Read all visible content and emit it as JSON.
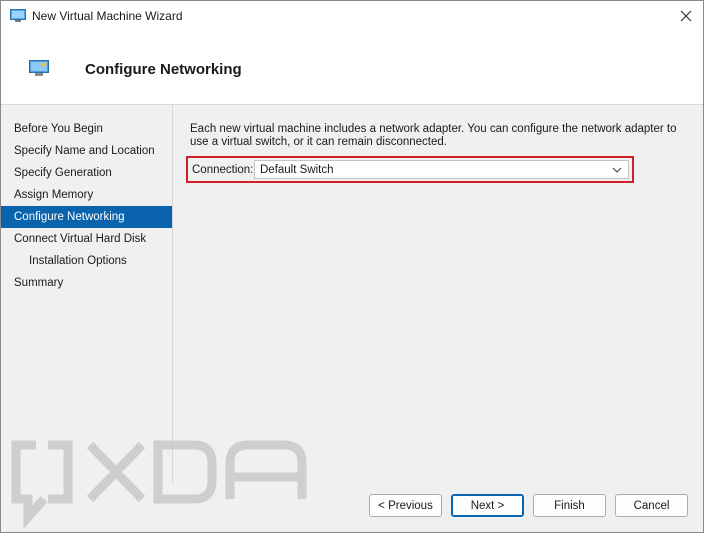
{
  "window": {
    "title": "New Virtual Machine Wizard"
  },
  "header": {
    "page_title": "Configure Networking"
  },
  "sidebar": {
    "items": [
      {
        "label": "Before You Begin",
        "active": false,
        "sub": false
      },
      {
        "label": "Specify Name and Location",
        "active": false,
        "sub": false
      },
      {
        "label": "Specify Generation",
        "active": false,
        "sub": false
      },
      {
        "label": "Assign Memory",
        "active": false,
        "sub": false
      },
      {
        "label": "Configure Networking",
        "active": true,
        "sub": false
      },
      {
        "label": "Connect Virtual Hard Disk",
        "active": false,
        "sub": false
      },
      {
        "label": "Installation Options",
        "active": false,
        "sub": true
      },
      {
        "label": "Summary",
        "active": false,
        "sub": false
      }
    ]
  },
  "content": {
    "description": "Each new virtual machine includes a network adapter. You can configure the network adapter to use a virtual switch, or it can remain disconnected.",
    "connection_label": "Connection:",
    "connection_value": "Default Switch"
  },
  "footer": {
    "previous_label": "< Previous",
    "next_label": "Next >",
    "finish_label": "Finish",
    "cancel_label": "Cancel"
  },
  "watermark": {
    "text": "XDA"
  },
  "colors": {
    "accent": "#0a64ad",
    "highlight_border": "#d0202a"
  }
}
